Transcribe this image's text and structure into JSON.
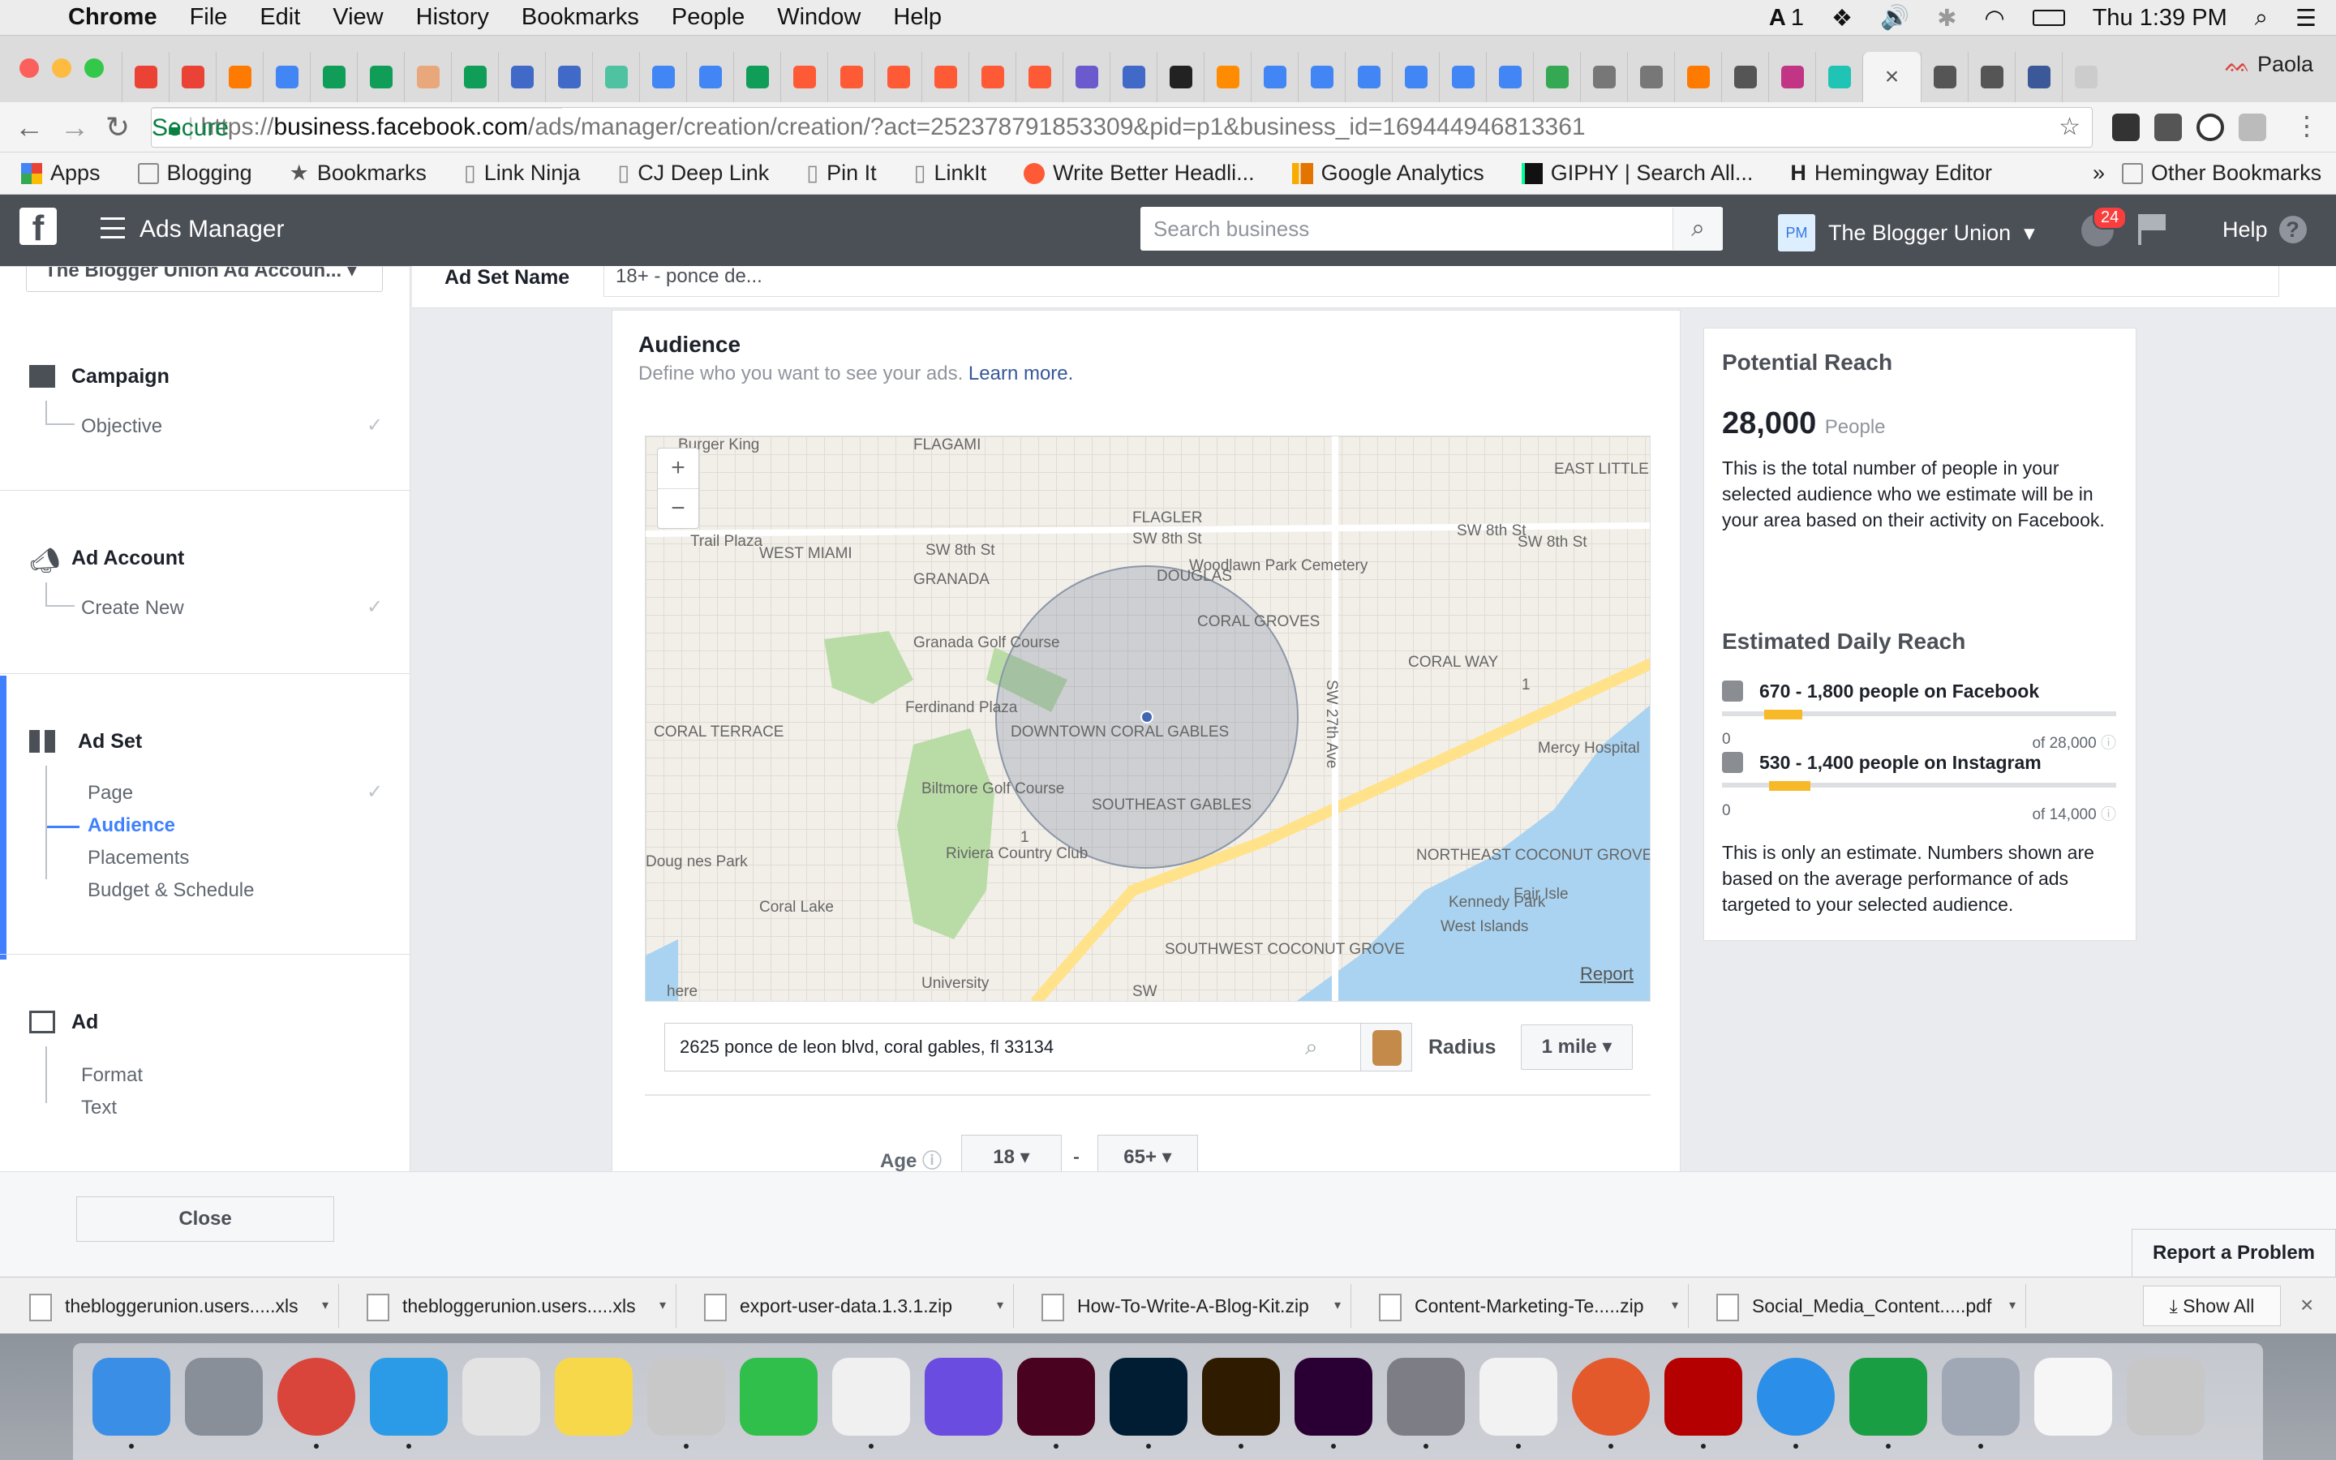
{
  "menubar": {
    "app": "Chrome",
    "items": [
      "File",
      "Edit",
      "View",
      "History",
      "Bookmarks",
      "People",
      "Window",
      "Help"
    ],
    "status_num": "1",
    "clock": "Thu 1:39 PM"
  },
  "chrome": {
    "profile": "Paola",
    "tab_close": "×",
    "tab_colors": [
      "#ea4335",
      "#ea4335",
      "#ff7a00",
      "#4285f4",
      "#0f9d58",
      "#0f9d58",
      "#e8a87c",
      "#0f9d58",
      "#4169c7",
      "#4169c7",
      "#4fc3a1",
      "#4285f4",
      "#4285f4",
      "#0f9d58",
      "#ff5a36",
      "#ff5a36",
      "#ff5a36",
      "#ff5a36",
      "#ff5a36",
      "#ff5a36",
      "#6a5acd",
      "#4169c7",
      "#222222",
      "#ff8c00",
      "#4285f4",
      "#4285f4",
      "#4285f4",
      "#4285f4",
      "#4285f4",
      "#4285f4",
      "#34a853",
      "#777777",
      "#777777",
      "#ff7a00",
      "#555555",
      "#c13584",
      "#20c4b4"
    ],
    "active_tab_colors": [
      "#555555",
      "#555555",
      "#3b5998",
      "#cccccc"
    ]
  },
  "address": {
    "secure": "Secure",
    "scheme": "https://",
    "domain": "business.facebook.com",
    "path": "/ads/manager/creation/creation/?act=252378791853309&pid=p1&business_id=169444946813361"
  },
  "bookmarks": {
    "items": [
      "Apps",
      "Blogging",
      "Bookmarks",
      "Link Ninja",
      "CJ Deep Link",
      "Pin It",
      "LinkIt",
      "Write Better Headli...",
      "Google Analytics",
      "GIPHY | Search All...",
      "Hemingway Editor"
    ],
    "overflow": "»",
    "other": "Other Bookmarks"
  },
  "fbheader": {
    "logo": "f",
    "title": "Ads Manager",
    "search_placeholder": "Search business",
    "account_initials": "PM",
    "account": "The Blogger Union",
    "notif_count": "24",
    "help": "Help",
    "help_icon": "?"
  },
  "leftnav": {
    "account_select": "The Blogger Union Ad Accoun...",
    "sections": [
      {
        "title": "Campaign",
        "items": [
          "Objective"
        ]
      },
      {
        "title": "Ad Account",
        "items": [
          "Create New"
        ]
      },
      {
        "title": "Ad Set",
        "items": [
          "Page",
          "Audience",
          "Placements",
          "Budget & Schedule"
        ]
      },
      {
        "title": "Ad",
        "items": [
          "Format",
          "Text"
        ]
      }
    ]
  },
  "adset": {
    "label": "Ad Set Name",
    "value": "18+ - ponce de..."
  },
  "audience": {
    "title": "Audience",
    "desc": "Define who you want to see your ads.",
    "learn": "Learn more.",
    "location": "2625 ponce de leon blvd, coral gables, fl 33134",
    "radius_label": "Radius",
    "radius": "1 mile",
    "age_label": "Age",
    "age_min": "18",
    "age_sep": "-",
    "age_max": "65+"
  },
  "map": {
    "report": "Report",
    "zoom_in": "+",
    "zoom_out": "−",
    "labels": [
      "WEST MIAMI",
      "SW 8th St",
      "SW 8th St",
      "SW 8th St",
      "SW 8th St",
      "FLAGLER",
      "DOUGLAS",
      "Woodlawn Park Cemetery",
      "CORAL GROVES",
      "GRANADA",
      "Granada Golf Course",
      "Ferdinand Plaza",
      "DOWNTOWN CORAL GABLES",
      "SOUTHEAST GABLES",
      "CORAL TERRACE",
      "Biltmore Golf Course",
      "Riviera Country Club",
      "Coral Lake",
      "CORAL WAY",
      "Mercy Hospital",
      "NORTHEAST COCONUT GROVE",
      "Kennedy Park",
      "Fair Isle",
      "West Islands",
      "SOUTHWEST COCONUT GROVE",
      "University",
      "EAST LITTLE HAVANA",
      "Trail Plaza",
      "SW 27th Ave",
      "Doug nes Park",
      "Burger King",
      "FLAGAMI",
      "here",
      "1",
      "1",
      "SW"
    ]
  },
  "reach": {
    "title": "Potential Reach",
    "count": "28,000",
    "unit": "People",
    "desc": "This is the total number of people in your selected audience who we estimate will be in your area based on their activity on Facebook.",
    "daily_title": "Estimated Daily Reach",
    "fb": {
      "text": "670 - 1,800 people on Facebook",
      "lo": "0",
      "hi": "of 28,000",
      "low_frac": 0.024,
      "high_frac": 0.064
    },
    "ig": {
      "text": "530 - 1,400 people on Instagram",
      "lo": "0",
      "hi": "of 14,000",
      "low_frac": 0.038,
      "high_frac": 0.1
    },
    "note": "This is only an estimate. Numbers shown are based on the average performance of ads targeted to your selected audience."
  },
  "bottom": {
    "close": "Close",
    "report": "Report a Problem"
  },
  "downloads": {
    "items": [
      "thebloggerunion.users.....xls",
      "thebloggerunion.users.....xls",
      "export-user-data.1.3.1.zip",
      "How-To-Write-A-Blog-Kit.zip",
      "Content-Marketing-Te.....zip",
      "Social_Media_Content.....pdf"
    ],
    "arrow": "▾",
    "show_all": "Show All",
    "close": "×"
  },
  "dock": {
    "colors": [
      "#3a8ee6",
      "#888f99",
      "#d9453a",
      "#2b9be8",
      "#e3e3e3",
      "#f7d84a",
      "#c8c8c8",
      "#2fbf4a",
      "#f0f0f0",
      "#6a4ce0",
      "#49021f",
      "#001d34",
      "#2e1b00",
      "#2a0034",
      "#7d7d85",
      "#f2f2f2",
      "#e3592b",
      "#b40000",
      "#2b8ee8",
      "#1a9e44",
      "#a0a8b5",
      "#f6f6f6",
      "#c7c7c7"
    ]
  }
}
